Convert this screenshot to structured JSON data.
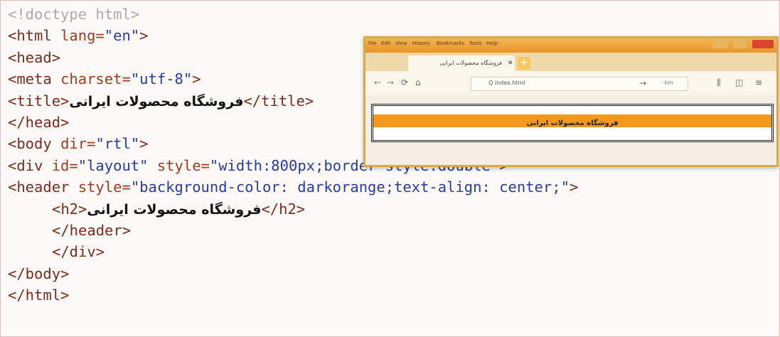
{
  "code": {
    "l1": {
      "open": "<!doctype html>"
    },
    "l2": {
      "open": "<html ",
      "attr": "lang=",
      "val": "\"en\"",
      "close": ">"
    },
    "l3": {
      "open": "<head>"
    },
    "l4": {
      "open": "<meta ",
      "attr": "charset=",
      "val": "\"utf-8\"",
      "close": ">"
    },
    "l5": {
      "open": "<title>",
      "text": "فروشگاه محصولات ایرانی",
      "close": "</title>"
    },
    "l6": {
      "open": "</head>"
    },
    "l7": {
      "open": "<body ",
      "attr": "dir=",
      "val": "\"rtl\"",
      "close": ">"
    },
    "l8": {
      "open": "<div ",
      "attr1": "id=",
      "val1": "\"layout\"",
      "attr2": " style=",
      "val2": "\"width:800px;border-style:double\"",
      "close": ">"
    },
    "l9": {
      "open": "<header ",
      "attr": "style=",
      "val": "\"background-color: darkorange;text-align: center;\"",
      "close": ">"
    },
    "l10": {
      "open": "<h2>",
      "text": "فروشگاه محصولات ایرانی",
      "close": "</h2>"
    },
    "l11": {
      "open": "</header>"
    },
    "l12": {
      "open": "</div>"
    },
    "l13": {
      "open": "</body>"
    },
    "l14": {
      "open": "</html>"
    }
  },
  "browser": {
    "menu": [
      "File",
      "Edit",
      "View",
      "History",
      "Bookmarks",
      "Tools",
      "Help"
    ],
    "tab_close": "✕",
    "tab_title": "فروشگاه محصولات ایرانی",
    "new_tab": "+",
    "back": "←",
    "forward": "→",
    "reload": "⟳",
    "home": "⌂",
    "url": "Q  index.html",
    "go": "→",
    "search_engine": "· ·km",
    "library": "⫼",
    "sidebar": "◫",
    "menu_button": "≡",
    "page_heading": "فروشگاه محصولات ایرانی"
  },
  "colors": {
    "tag": "#7a2a1e",
    "attribute": "#a03a20",
    "value": "#2a3aa0",
    "darkorange": "#f39a1e"
  }
}
